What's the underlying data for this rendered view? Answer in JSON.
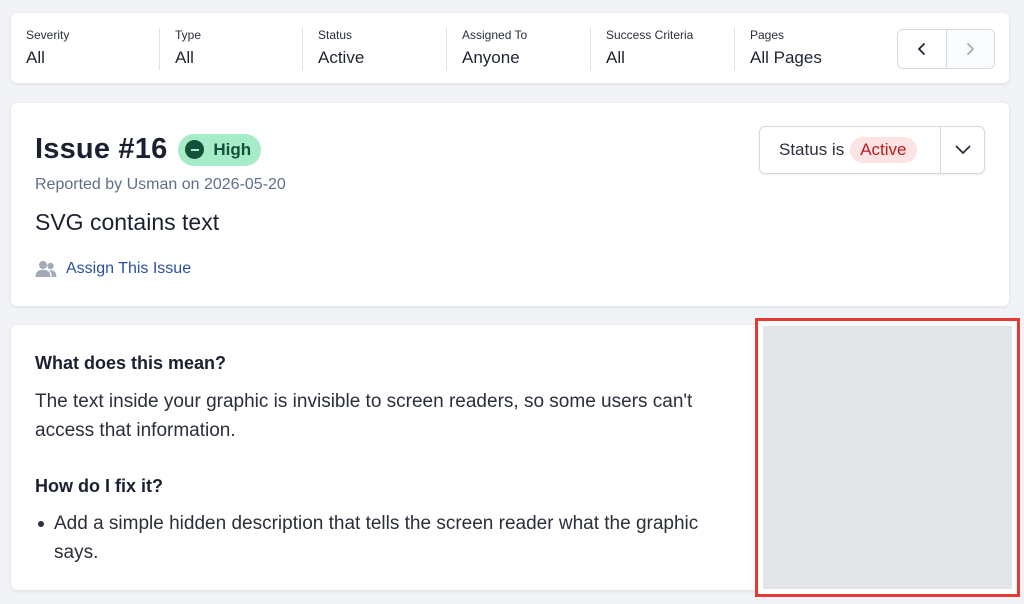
{
  "filters": [
    {
      "label": "Severity",
      "value": "All"
    },
    {
      "label": "Type",
      "value": "All"
    },
    {
      "label": "Status",
      "value": "Active"
    },
    {
      "label": "Assigned To",
      "value": "Anyone"
    },
    {
      "label": "Success Criteria",
      "value": "All"
    },
    {
      "label": "Pages",
      "value": "All Pages"
    }
  ],
  "pager": {
    "prev_icon": "chevron-left-icon",
    "next_icon": "chevron-right-icon"
  },
  "issue": {
    "title": "Issue #16",
    "severity": "High",
    "reported": "Reported by Usman on 2026-05-20",
    "summary": "SVG contains text",
    "assign_label": "Assign This Issue",
    "status_prefix": "Status is",
    "status_value": "Active"
  },
  "details": {
    "meaning_heading": "What does this mean?",
    "meaning_body": "The text inside your graphic is invisible to screen readers, so some users can't access that information.",
    "fix_heading": "How do I fix it?",
    "fix_items": [
      "Add a simple hidden description that tells the screen reader what the graphic says."
    ]
  },
  "colors": {
    "accent_link": "#2b4fa0",
    "severity_high_bg": "#a7ecc8",
    "severity_high_fg": "#14503a",
    "status_active_bg": "#fde3e3",
    "status_active_fg": "#b91c1c",
    "highlight_border": "#e53935"
  }
}
